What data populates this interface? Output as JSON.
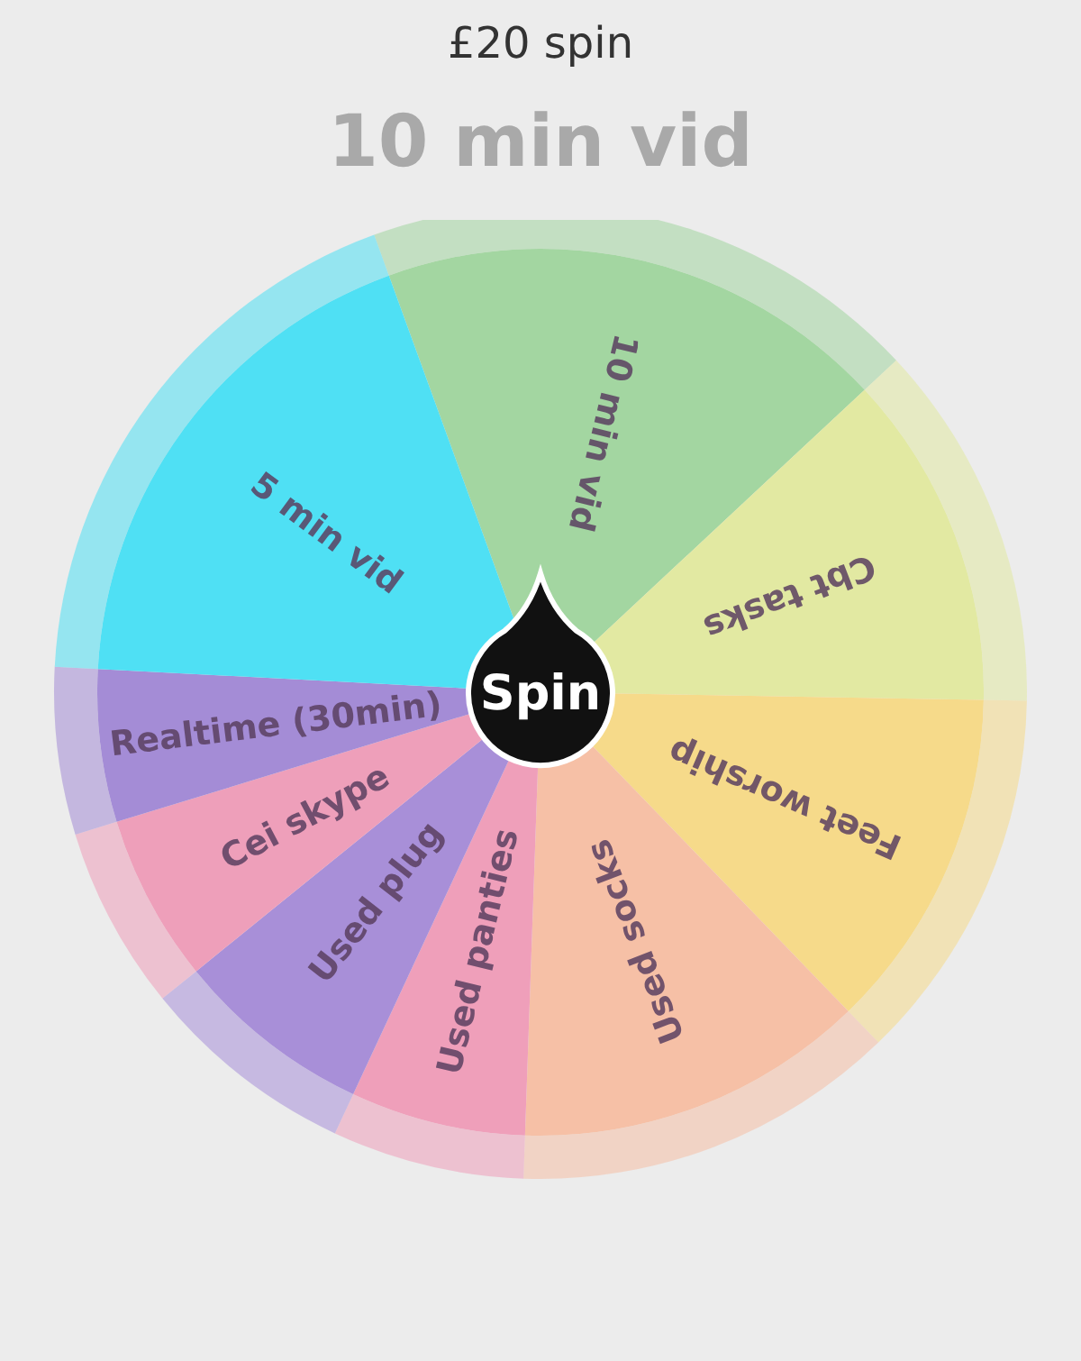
{
  "header": {
    "title": "£20 spin",
    "result": "10 min vid"
  },
  "wheel": {
    "spin_button": "Spin",
    "segments": [
      {
        "label": "10 min vid",
        "color": "#a3d6a1"
      },
      {
        "label": "Cbt tasks",
        "color": "#e2e9a2"
      },
      {
        "label": "Feet worship",
        "color": "#f6da8a"
      },
      {
        "label": "Used socks",
        "color": "#f6c0a6"
      },
      {
        "label": "Used panties",
        "color": "#ef9fba"
      },
      {
        "label": "Used plug",
        "color": "#a88fd8"
      },
      {
        "label": "Cei skype",
        "color": "#ee9fba"
      },
      {
        "label": "Realtime (30min)",
        "color": "#a48cd6"
      },
      {
        "label": "5 min vid",
        "color": "#4fe0f4"
      }
    ]
  }
}
